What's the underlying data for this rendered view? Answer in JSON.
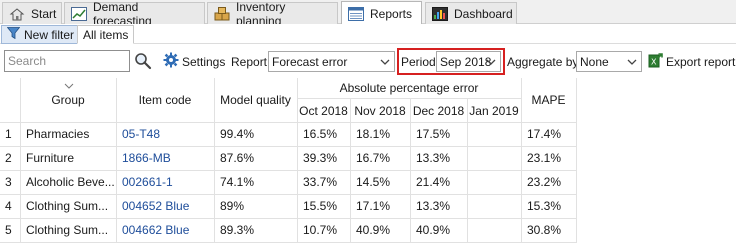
{
  "tabs": [
    {
      "label": "Start",
      "icon": "home-icon"
    },
    {
      "label": "Demand forecasting",
      "icon": "chart-icon"
    },
    {
      "label": "Inventory planning",
      "icon": "boxes-icon"
    },
    {
      "label": "Reports",
      "icon": "report-icon",
      "active": true
    },
    {
      "label": "Dashboard",
      "icon": "dashboard-icon"
    }
  ],
  "subtabs": {
    "new_filter": "New filter",
    "all_items": "All items"
  },
  "toolbar": {
    "search_placeholder": "Search",
    "settings_label": "Settings",
    "report_label": "Report",
    "report_value": "Forecast error",
    "period_label": "Period",
    "period_value": "Sep 2018",
    "aggregate_label": "Aggregate by",
    "aggregate_value": "None",
    "export_label": "Export report"
  },
  "table": {
    "headers": {
      "group": "Group",
      "item_code": "Item code",
      "model_quality": "Model quality",
      "ape_group": "Absolute percentage error",
      "months": [
        "Oct 2018",
        "Nov 2018",
        "Dec 2018",
        "Jan 2019"
      ],
      "mape": "MAPE"
    },
    "rows": [
      {
        "n": "1",
        "group": "Pharmacies",
        "item": "05-T48",
        "quality": "99.4%",
        "m1": "16.5%",
        "m2": "18.1%",
        "m3": "17.5%",
        "m4": "",
        "mape": "17.4%"
      },
      {
        "n": "2",
        "group": "Furniture",
        "item": "1866-MB",
        "quality": "87.6%",
        "m1": "39.3%",
        "m2": "16.7%",
        "m3": "13.3%",
        "m4": "",
        "mape": "23.1%"
      },
      {
        "n": "3",
        "group": "Alcoholic Beve...",
        "item": "002661-1",
        "quality": "74.1%",
        "m1": "33.7%",
        "m2": "14.5%",
        "m3": "21.4%",
        "m4": "",
        "mape": "23.2%"
      },
      {
        "n": "4",
        "group": "Clothing Sum...",
        "item": "004652 Blue",
        "quality": "89%",
        "m1": "15.5%",
        "m2": "17.1%",
        "m3": "13.3%",
        "m4": "",
        "mape": "15.3%"
      },
      {
        "n": "5",
        "group": "Clothing Sum...",
        "item": "004662 Blue",
        "quality": "89.3%",
        "m1": "10.7%",
        "m2": "40.9%",
        "m3": "40.9%",
        "m4": "",
        "mape": "30.8%"
      }
    ]
  },
  "colors": {
    "accent_red": "#d62020",
    "link_blue": "#1e4d9a"
  }
}
